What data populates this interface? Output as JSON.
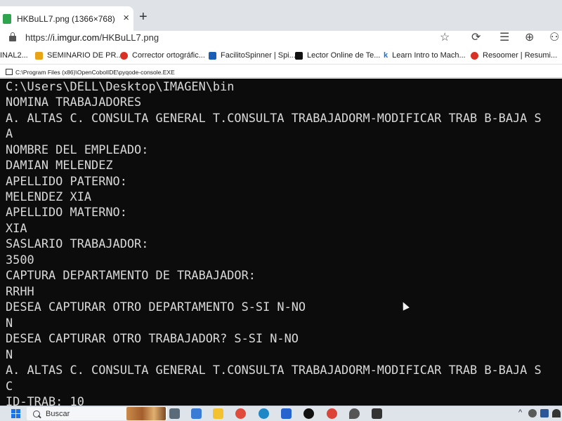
{
  "browser": {
    "tab_title": "HKBuLL7.png (1366×768)",
    "tab_close": "×",
    "new_tab": "+",
    "url_prefix": "https://",
    "url_host": "i.imgur.com",
    "url_path": "/HKBuLL7.png",
    "toolbar_icons": [
      "star-icon",
      "extensions-icon",
      "favorites-icon",
      "collections-icon",
      "profile-icon"
    ]
  },
  "bookmarks": [
    {
      "label": "INAL2...",
      "icon_color": "#ffffff"
    },
    {
      "label": "SEMINARIO DE PR...",
      "icon_color": "#e8a317"
    },
    {
      "label": "Corrector ortográfic...",
      "icon_color": "#d93025"
    },
    {
      "label": "FacilitoSpinner | Spi...",
      "icon_color": "#1a5fb4"
    },
    {
      "label": "Lector Online de Te...",
      "icon_color": "#111111"
    },
    {
      "label": "Learn Intro to Mach...",
      "icon_color": "#1f6fd6"
    },
    {
      "label": "Resoomer | Resumi...",
      "icon_color": "#d93025"
    }
  ],
  "console": {
    "title": "C:\\Program Files (x86)\\OpenCobolIDE\\pyqode-console.EXE",
    "lines": [
      "C:\\Users\\DELL\\Desktop\\IMAGEN\\bin",
      "NOMINA TRABAJADORES",
      "A. ALTAS C. CONSULTA GENERAL T.CONSULTA TRABAJADORM-MODIFICAR TRAB B-BAJA S",
      "A",
      "NOMBRE DEL EMPLEADO:",
      "DAMIAN MELENDEZ",
      "APELLIDO PATERNO:",
      "MELENDEZ XIA",
      "APELLIDO MATERNO:",
      "XIA",
      "SASLARIO TRABAJADOR:",
      "3500",
      "CAPTURA DEPARTAMENTO DE TRABAJADOR:",
      "RRHH",
      "DESEA CAPTURAR OTRO DEPARTAMENTO S-SI N-NO",
      "N",
      "DESEA CAPTURAR OTRO TRABAJADOR? S-SI N-NO",
      "N",
      "A. ALTAS C. CONSULTA GENERAL T.CONSULTA TRABAJADORM-MODIFICAR TRAB B-BAJA S",
      "C",
      "ID-TRAB: 10"
    ],
    "colors": {
      "background": "#0c0c0c",
      "text": "#d9d9d9"
    }
  },
  "taskbar": {
    "search_placeholder": "Buscar",
    "apps": [
      {
        "name": "task-view-icon",
        "color": "#5b6b7a"
      },
      {
        "name": "files-app-icon",
        "color": "#3a7bd5"
      },
      {
        "name": "file-explorer-icon",
        "color": "#f2c230"
      },
      {
        "name": "chrome-icon",
        "color": "#e14b3b"
      },
      {
        "name": "edge-icon",
        "color": "#1e88c7"
      },
      {
        "name": "todo-icon",
        "color": "#2564cf"
      },
      {
        "name": "tiktok-icon",
        "color": "#111111"
      },
      {
        "name": "chrome-profile-icon",
        "color": "#db4437"
      },
      {
        "name": "drop-app-icon",
        "color": "#555555"
      },
      {
        "name": "console-app-icon",
        "color": "#333333"
      }
    ],
    "tray_icons": [
      {
        "name": "network-icon",
        "color": "#5a5a5a"
      },
      {
        "name": "word-icon",
        "color": "#2b579a"
      },
      {
        "name": "wifi-icon",
        "color": "#333333"
      }
    ]
  }
}
